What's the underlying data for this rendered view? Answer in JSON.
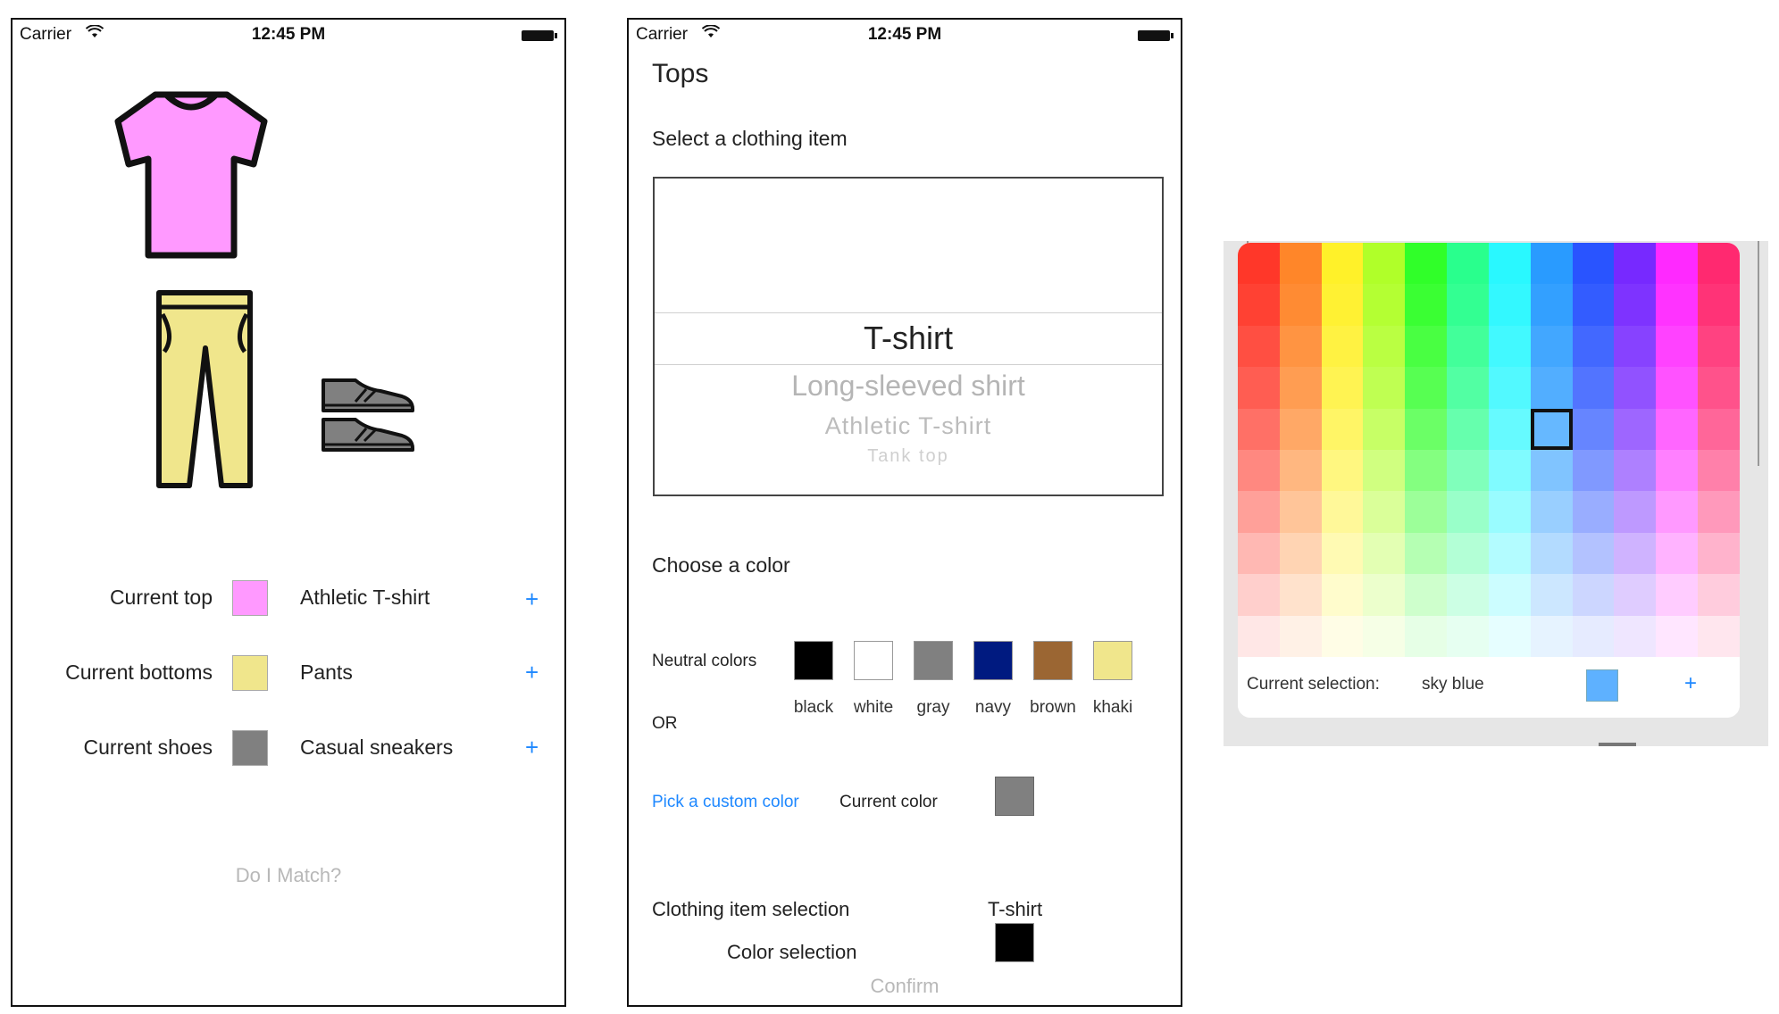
{
  "status_bar": {
    "carrier": "Carrier",
    "time": "12:45 PM"
  },
  "screen1": {
    "rows": [
      {
        "label": "Current top",
        "swatch": "#ff99ff",
        "value": "Athletic T-shirt"
      },
      {
        "label": "Current bottoms",
        "swatch": "#f0e68c",
        "value": "Pants"
      },
      {
        "label": "Current shoes",
        "swatch": "#808080",
        "value": "Casual sneakers"
      }
    ],
    "add_label": "+",
    "match_button": "Do I Match?",
    "colors": {
      "top": "#ff99ff",
      "bottoms": "#f0e68c",
      "shoes": "#808080",
      "outline": "#111111"
    }
  },
  "screen2": {
    "title": "Tops",
    "select_heading": "Select a clothing item",
    "picker_options": [
      "T-shirt",
      "Long-sleeved shirt",
      "Athletic T-shirt",
      "Tank top"
    ],
    "choose_color_heading": "Choose a color",
    "neutral_label": "Neutral colors",
    "neutral_colors": [
      {
        "name": "black",
        "hex": "#000000"
      },
      {
        "name": "white",
        "hex": "#ffffff"
      },
      {
        "name": "gray",
        "hex": "#808080"
      },
      {
        "name": "navy",
        "hex": "#001a80"
      },
      {
        "name": "brown",
        "hex": "#9b6633"
      },
      {
        "name": "khaki",
        "hex": "#f0e68c"
      }
    ],
    "or_label": "OR",
    "custom_link": "Pick a custom color",
    "current_color_label": "Current color",
    "current_color": "#808080",
    "item_selection_label": "Clothing item selection",
    "item_selection_value": "T-shirt",
    "color_selection_label": "Color selection",
    "color_selection_value": "#000000",
    "confirm_button": "Confirm"
  },
  "color_grid": {
    "selected_cell": {
      "row": 4,
      "col": 7
    },
    "current_selection_label": "Current selection:",
    "current_selection_name": "sky blue",
    "current_selection_hex": "#5eb1ff",
    "add_label": "+"
  },
  "theme": {
    "accent": "#1e88ff",
    "disabled_text": "#b8b8b8"
  }
}
